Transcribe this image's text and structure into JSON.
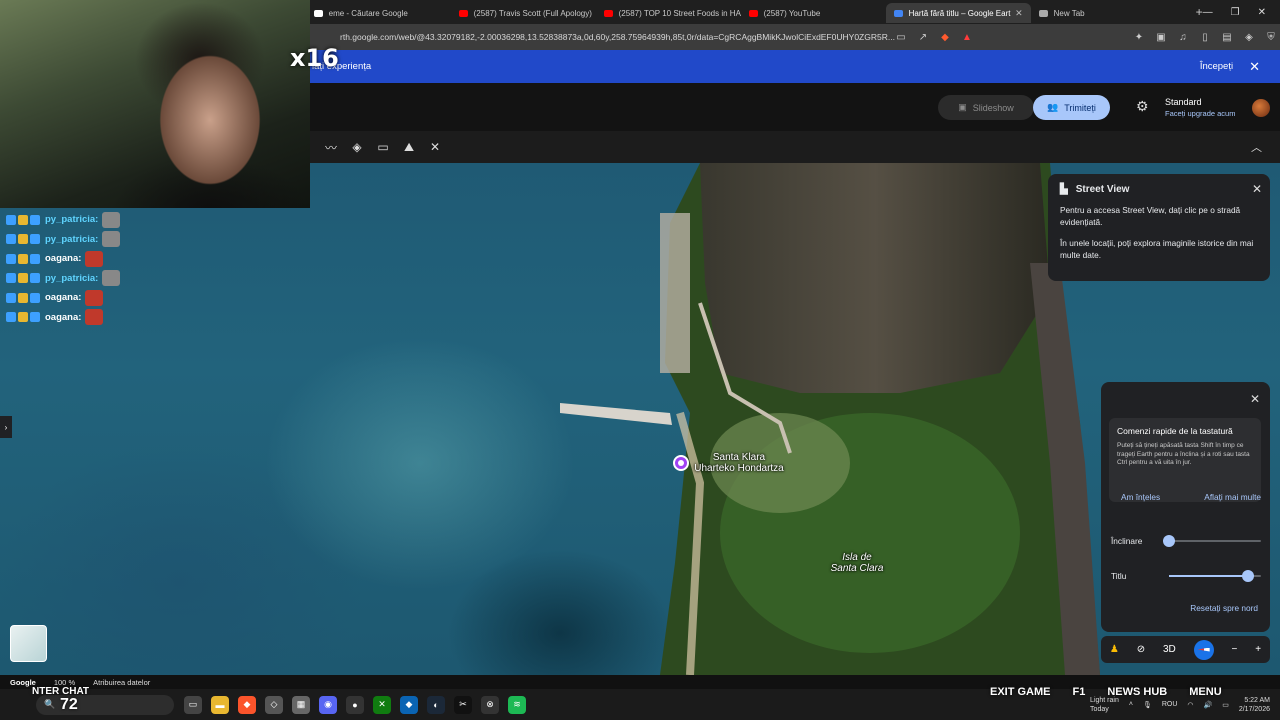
{
  "browser": {
    "tabs": [
      {
        "title": "eme - Căutare Google",
        "color": "#ffffff",
        "active": false
      },
      {
        "title": "(2587) Travis Scott (Full Apology)",
        "color": "#ff0000",
        "active": false
      },
      {
        "title": "(2587) TOP 10 Street Foods in HA",
        "color": "#ff0000",
        "active": false
      },
      {
        "title": "(2587) YouTube",
        "color": "#ff0000",
        "active": false
      },
      {
        "title": "Hartă fără titlu – Google Eart",
        "color": "#4285f4",
        "active": true
      },
      {
        "title": "New Tab",
        "color": "#aaaaaa",
        "active": false
      }
    ],
    "url": "rth.google.com/web/@43.32079182,-2.00036298,13.52838873a,0d,60y,258.75964939h,85t,0r/data=CgRCAggBMikKJwolCiExdEF0UHY0ZGR5R..."
  },
  "banner": {
    "message": "iați experiența",
    "start_label": "Începeți"
  },
  "earth": {
    "slideshow_label": "Slideshow",
    "share_label": "Trimiteți",
    "plan_name": "Standard",
    "plan_upgrade": "Faceți upgrade acum"
  },
  "map": {
    "place_label_1": "Santa Klara",
    "place_label_2": "Uharteko Hondartza",
    "island_label_1": "Isla de",
    "island_label_2": "Santa Clara"
  },
  "street_view": {
    "title": "Street View",
    "text1": "Pentru a accesa Street View, dați clic pe o stradă evidențiată.",
    "text2": "În unele locații, poți explora imaginile istorice din mai multe date."
  },
  "shortcuts": {
    "title": "Comenzi rapide de la tastatură",
    "text": "Puteți să țineți apăsată tasta Shift în timp ce trageți Earth pentru a înclina și a roti sau tasta Ctrl pentru a vă uita în jur.",
    "ok_label": "Am înțeles",
    "more_label": "Aflați mai multe"
  },
  "view": {
    "tilt_label": "Înclinare",
    "tilt_value": 0.0,
    "title_label": "Titlu",
    "title_value": 0.86,
    "reset_label": "Resetați spre nord",
    "mode_3d": "3D"
  },
  "status": {
    "logo": "Google",
    "zoom": "100 %",
    "attribution": "Atribuirea datelor"
  },
  "stream": {
    "multiplier": "x16",
    "ammo": "72",
    "hud_left": "NTER  CHAT",
    "hud_exit": "EXIT GAME",
    "hud_f1": "F1",
    "hud_news": "NEWS HUB",
    "hud_menu": "MENU",
    "chat": [
      {
        "name": "py_patricia:",
        "color": "#5fd4ff"
      },
      {
        "name": "py_patricia:",
        "color": "#5fd4ff"
      },
      {
        "name": "oagana:",
        "color": "#ffffff"
      },
      {
        "name": "py_patricia:",
        "color": "#5fd4ff"
      },
      {
        "name": "oagana:",
        "color": "#ffffff"
      },
      {
        "name": "oagana:",
        "color": "#ffffff"
      }
    ]
  },
  "taskbar": {
    "weather": "Light rain",
    "weather_sub": "Today",
    "lang": "ROU",
    "time": "5:22 AM",
    "date": "2/17/2026"
  }
}
